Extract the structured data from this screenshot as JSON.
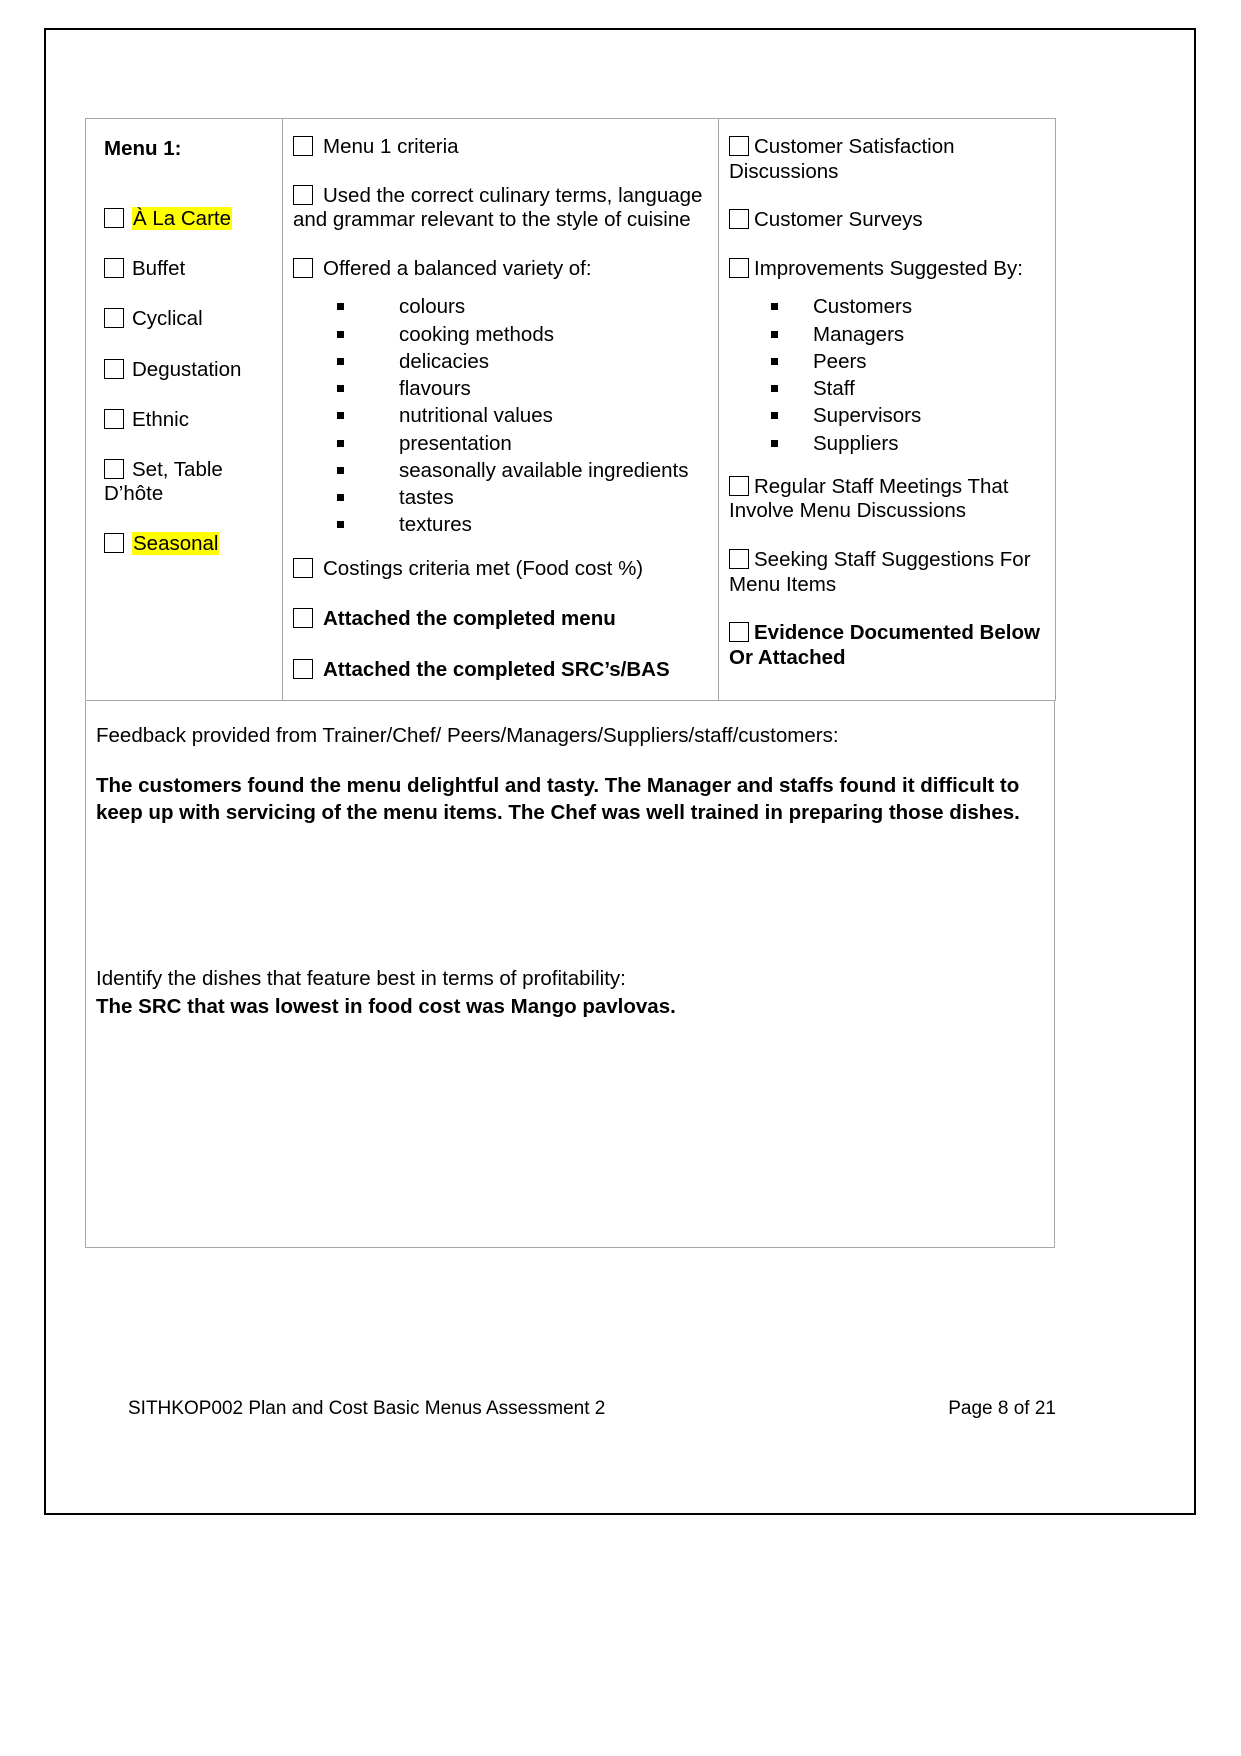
{
  "document": {
    "menu_column": {
      "title": "Menu 1:",
      "items": [
        {
          "label": "À La Carte",
          "highlighted": true
        },
        {
          "label": "Buffet",
          "highlighted": false
        },
        {
          "label": "Cyclical",
          "highlighted": false
        },
        {
          "label": "Degustation",
          "highlighted": false
        },
        {
          "label": "Ethnic",
          "highlighted": false
        },
        {
          "label": "Set, Table D’hôte",
          "highlighted": false
        },
        {
          "label": "Seasonal",
          "highlighted": true
        }
      ]
    },
    "criteria_column": {
      "rows": [
        {
          "label": "Menu 1 criteria",
          "bold": false
        },
        {
          "label": "Used the correct culinary terms, language and grammar relevant to the style of cuisine",
          "bold": false
        },
        {
          "label": "Offered a balanced variety of:",
          "bold": false
        }
      ],
      "variety_list": [
        "colours",
        "cooking methods",
        "delicacies",
        "flavours",
        "nutritional values",
        "presentation",
        "seasonally available ingredients",
        "tastes",
        "textures"
      ],
      "rows_after": [
        {
          "label": "Costings criteria met (Food cost %)",
          "bold": false
        },
        {
          "label": "Attached the completed menu",
          "bold": true
        },
        {
          "label": "Attached the completed SRC’s/BAS",
          "bold": true
        }
      ]
    },
    "feedback_column": {
      "rows_top": [
        {
          "label": "Customer Satisfaction Discussions",
          "bold": false
        },
        {
          "label": "Customer Surveys",
          "bold": false
        },
        {
          "label": "Improvements Suggested By:",
          "bold": false
        }
      ],
      "suggested_by": [
        "Customers",
        "Managers",
        "Peers",
        "Staff",
        "Supervisors",
        "Suppliers"
      ],
      "rows_bottom": [
        {
          "label": "Regular Staff Meetings That Involve Menu Discussions",
          "bold": false
        },
        {
          "label": "Seeking Staff Suggestions For Menu Items",
          "bold": false
        },
        {
          "label": "Evidence Documented Below Or Attached",
          "bold": true
        }
      ]
    },
    "answers": {
      "feedback_prompt": "Feedback provided from Trainer/Chef/ Peers/Managers/Suppliers/staff/customers:",
      "feedback_answer": "The customers found the menu delightful and tasty. The Manager and staffs found it difficult to keep up with servicing of the menu items. The Chef was well trained in preparing those dishes.",
      "profitability_prompt": "Identify the dishes that feature best in terms of profitability:",
      "profitability_answer": "The SRC that was lowest in food cost was Mango pavlovas."
    },
    "footer": {
      "left": "SITHKOP002 Plan and Cost Basic Menus Assessment 2",
      "right": "Page 8 of 21"
    },
    "colors": {
      "highlight": "#ffff00",
      "table_border": "#a6a6a6",
      "page_border": "#000000"
    }
  }
}
